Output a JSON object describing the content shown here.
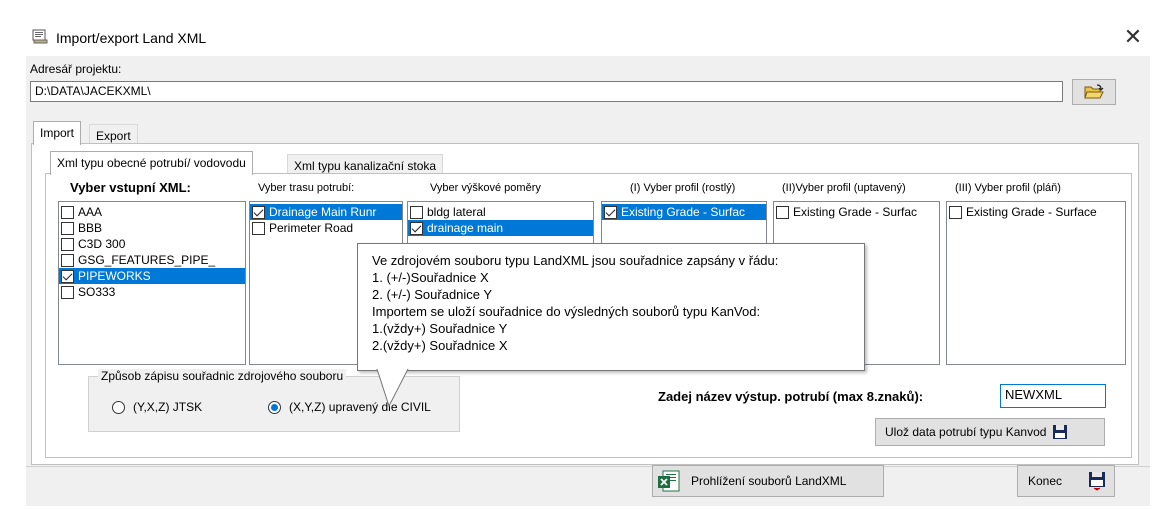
{
  "window": {
    "title": "Import/export Land XML",
    "close_glyph": "✕"
  },
  "project": {
    "label": "Adresář projektu:",
    "path": "D:\\DATA\\JACEKXML\\"
  },
  "tabs_outer": [
    {
      "label": "Import",
      "active": true
    },
    {
      "label": "Export",
      "active": false
    }
  ],
  "tabs_inner": [
    {
      "label": "Xml typu obecné potrubí/ vodovodu",
      "active": true
    },
    {
      "label": "Xml typu kanalizační stoka",
      "active": false
    }
  ],
  "columns": {
    "input_xml": {
      "header": "Vyber vstupní XML:",
      "items": [
        {
          "label": "AAA",
          "checked": false,
          "selected": false
        },
        {
          "label": "BBB",
          "checked": false,
          "selected": false
        },
        {
          "label": "C3D 300",
          "checked": false,
          "selected": false
        },
        {
          "label": "GSG_FEATURES_PIPE_",
          "checked": false,
          "selected": false
        },
        {
          "label": "PIPEWORKS",
          "checked": true,
          "selected": true
        },
        {
          "label": "SO333",
          "checked": false,
          "selected": false
        }
      ]
    },
    "pipe_route": {
      "header": "Vyber trasu potrubí:",
      "items": [
        {
          "label": "Drainage Main Runr",
          "checked": true,
          "selected": true
        },
        {
          "label": "Perimeter Road",
          "checked": false,
          "selected": false
        }
      ]
    },
    "height": {
      "header": "Vyber výškové poměry",
      "items": [
        {
          "label": "bldg lateral",
          "checked": false,
          "selected": false
        },
        {
          "label": "drainage main",
          "checked": true,
          "selected": true
        }
      ]
    },
    "profile1": {
      "header": "(I) Vyber profil (rostlý)",
      "items": [
        {
          "label": "Existing Grade - Surfac",
          "checked": true,
          "selected": true
        }
      ]
    },
    "profile2": {
      "header": "(II)Vyber profil (uptavený)",
      "items": [
        {
          "label": "Existing Grade - Surfac",
          "checked": false,
          "selected": false
        }
      ]
    },
    "profile3": {
      "header": "(III) Vyber  profil (pláň)",
      "items": [
        {
          "label": "Existing Grade - Surface",
          "checked": false,
          "selected": false
        }
      ]
    }
  },
  "coord_mode": {
    "legend": "Způsob zápisu souřadnic zdrojového souboru",
    "options": [
      {
        "label": "(Y,X,Z) JTSK",
        "selected": false
      },
      {
        "label": "(X,Y,Z) upravený dle CIVIL",
        "selected": true
      }
    ]
  },
  "tooltip": {
    "lines": [
      "Ve zdrojovém souboru typu LandXML jsou souřadnice zapsány v  řádu:",
      "1.  (+/-)Souřadnice X",
      "2.  (+/-) Souřadnice Y",
      "Importem  se  uloží souřadnice do výsledných souborů typu KanVod:",
      "1.(vždy+) Souřadnice Y",
      "2.(vždy+) Souřadnice X"
    ]
  },
  "output": {
    "label": "Zadej název výstup. potrubí  (max 8.znaků):",
    "value": "NEWXML"
  },
  "buttons": {
    "save": "Ulož data potrubí typu Kanvod",
    "view": "Prohlížení souborů LandXML",
    "end": "Konec"
  },
  "colors": {
    "selection": "#0078d7",
    "face": "#f0f0f0"
  }
}
